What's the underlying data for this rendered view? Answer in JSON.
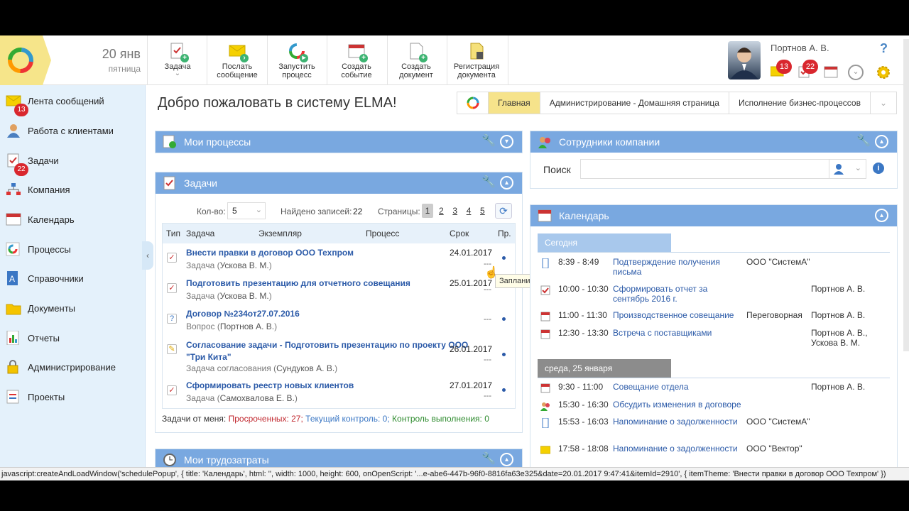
{
  "header": {
    "date_day": "20 янв",
    "date_weekday": "пятница",
    "toolbar": [
      {
        "label": "Задача",
        "icon": "task-icon"
      },
      {
        "label": "Послать\nсообщение",
        "icon": "message-icon"
      },
      {
        "label": "Запустить\nпроцесс",
        "icon": "process-icon"
      },
      {
        "label": "Создать\nсобытие",
        "icon": "event-icon"
      },
      {
        "label": "Создать\nдокумент",
        "icon": "document-icon"
      },
      {
        "label": "Регистрация\nдокумента",
        "icon": "register-icon"
      }
    ],
    "task_dropdown_arrow": "⌄",
    "user_name": "Портнов А. В.",
    "messages_badge": "13",
    "tasks_badge": "22",
    "help": "?"
  },
  "sidebar": {
    "items": [
      {
        "label": "Лента сообщений",
        "icon": "messages-icon",
        "badge": "13"
      },
      {
        "label": "Работа с клиентами",
        "icon": "clients-icon"
      },
      {
        "label": "Задачи",
        "icon": "tasks-icon",
        "badge": "22"
      },
      {
        "label": "Компания",
        "icon": "company-icon"
      },
      {
        "label": "Календарь",
        "icon": "calendar-icon"
      },
      {
        "label": "Процессы",
        "icon": "processes-icon"
      },
      {
        "label": "Справочники",
        "icon": "catalogs-icon"
      },
      {
        "label": "Документы",
        "icon": "documents-icon"
      },
      {
        "label": "Отчеты",
        "icon": "reports-icon"
      },
      {
        "label": "Администрирование",
        "icon": "admin-icon"
      },
      {
        "label": "Проекты",
        "icon": "projects-icon"
      }
    ]
  },
  "main": {
    "welcome": "Добро пожаловать в систему ELMA!",
    "tabs": [
      {
        "label": "Главная",
        "active": true
      },
      {
        "label": "Администрирование - Домашняя страница",
        "active": false
      },
      {
        "label": "Исполнение бизнес-процессов",
        "active": false
      }
    ],
    "my_processes_title": "Мои процессы",
    "tasks_panel": {
      "title": "Задачи",
      "count_label": "Кол-во:",
      "count_value": "5",
      "found_label": "Найдено записей:",
      "found_value": "22",
      "pages_label": "Страницы:",
      "pages": [
        "1",
        "2",
        "3",
        "4",
        "5"
      ],
      "columns": [
        "Тип",
        "Задача",
        "Экземпляр",
        "Процесс",
        "Срок",
        "Пр."
      ],
      "rows": [
        {
          "title": "Внести правки в договор ООО Техпром",
          "sub_prefix": "Задача (",
          "sub_person": "Ускова В. М.",
          "sub_suffix": ")",
          "date": "24.01.2017",
          "dash": "---"
        },
        {
          "title": "Подготовить презентацию для отчетного совещания",
          "sub_prefix": "Задача (",
          "sub_person": "Ускова В. М.",
          "sub_suffix": ")",
          "date": "25.01.2017",
          "dash": "---"
        },
        {
          "title": "Договор №234от27.07.2016",
          "sub_prefix": "Вопрос (",
          "sub_person": "Портнов А. В.",
          "sub_suffix": ")",
          "date": "",
          "dash": "---"
        },
        {
          "title": "Согласование задачи - Подготовить презентацию по проекту ООО \"Три Кита\"",
          "sub_prefix": "Задача согласования (",
          "sub_person": "Сундуков А. В.",
          "sub_suffix": ")",
          "date": "26.01.2017",
          "dash": "---"
        },
        {
          "title": "Сформировать реестр новых клиентов",
          "sub_prefix": "Задача (",
          "sub_person": "Самохвалова Е. В.",
          "sub_suffix": ")",
          "date": "27.01.2017",
          "dash": "---"
        }
      ],
      "footer_prefix": "Задачи от меня:",
      "overdue": "Просроченных: 27;",
      "current": "Текущий контроль: 0;",
      "control": "Контроль выполнения: 0"
    },
    "tooltip": "Запланировать",
    "labor_title": "Мои трудозатраты"
  },
  "right": {
    "employees_title": "Сотрудники компании",
    "search_label": "Поиск",
    "calendar_title": "Календарь",
    "today_label": "Сегодня",
    "today_events": [
      {
        "time": "8:39 - 8:49",
        "title": "Подтверждение получения письма",
        "place": "ООО \"СистемА\"",
        "who": ""
      },
      {
        "time": "10:00 - 10:30",
        "title": "Сформировать отчет за сентябрь 2016 г.",
        "place": "",
        "who": "Портнов А. В."
      },
      {
        "time": "11:00 - 11:30",
        "title": "Производственное совещание",
        "place": "Переговорная",
        "who": "Портнов А. В."
      },
      {
        "time": "12:30 - 13:30",
        "title": "Встреча с поставщиками",
        "place": "",
        "who": "Портнов А. В., Ускова В. М."
      }
    ],
    "wed_label": "среда, 25 января",
    "wed_events": [
      {
        "time": "9:30 - 11:00",
        "title": "Совещание отдела",
        "place": "",
        "who": "Портнов А. В."
      },
      {
        "time": "15:30 - 16:30",
        "title": "Обсудить изменения в договоре",
        "place": "",
        "who": ""
      },
      {
        "time": "15:53 - 16:03",
        "title": "Напоминание о задолженности",
        "place": "ООО \"СистемА\"",
        "who": ""
      },
      {
        "time": "17:58 - 18:08",
        "title": "Напоминание о задолженности",
        "place": "ООО \"Вектор\"",
        "who": ""
      }
    ]
  },
  "statusbar": "javascript:createAndLoadWindow('schedulePopup', { title: 'Календарь', html: '', width: 1000, height: 600, onOpenScript: '...e-abe6-447b-96f0-8816fa63e325&date=20.01.2017 9:47:41&itemId=2910', { itemTheme: 'Внести правки в договор ООО Техпром' })"
}
